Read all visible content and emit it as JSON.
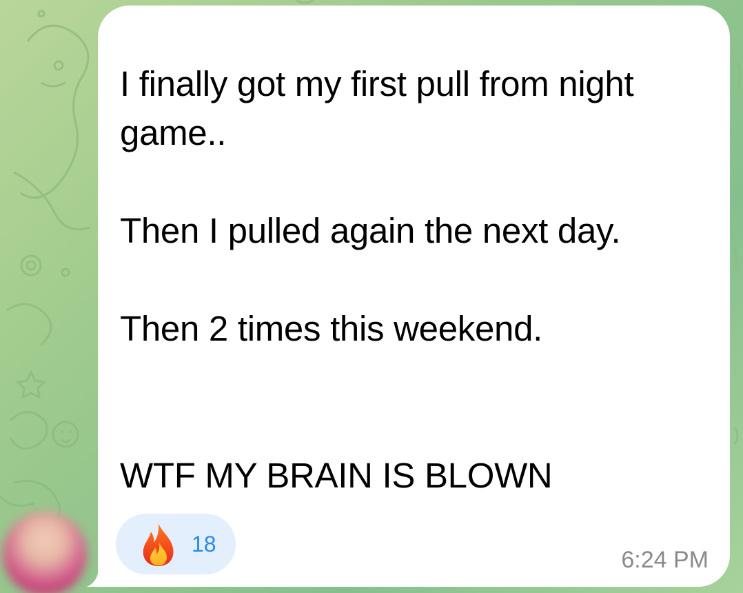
{
  "message": {
    "lines": [
      "I finally got my first pull from night game..",
      "Then I pulled again the next day.",
      "Then 2 times this weekend.",
      "WTF MY BRAIN IS BLOWN"
    ],
    "timestamp": "6:24 PM"
  },
  "reaction": {
    "emoji_icon": "fire-icon",
    "count": "18"
  },
  "sender": {
    "avatar_icon": "avatar"
  },
  "colors": {
    "bubble": "#ffffff",
    "reaction_background": "#e3effd",
    "reaction_count": "#2a8ae8",
    "timestamp": "#8a8a8e",
    "wallpaper": "#9cc98c"
  }
}
